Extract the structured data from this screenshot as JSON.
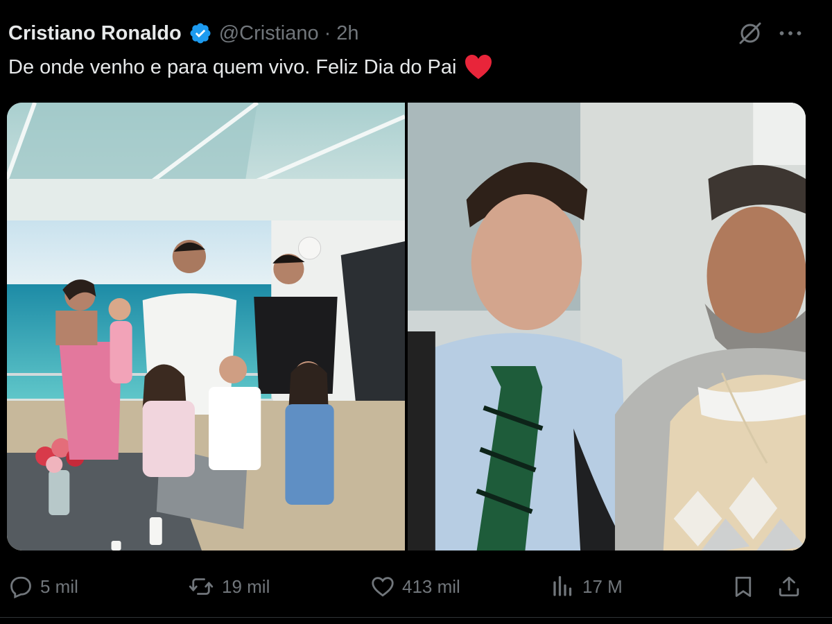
{
  "tweet": {
    "author_name": "Cristiano Ronaldo",
    "handle": "@Cristiano",
    "separator": "·",
    "time": "2h",
    "text": "De onde venho e para quem vivo. Feliz Dia do Pai",
    "emoji": "red-heart",
    "media": [
      {
        "name": "family-on-yacht-photo"
      },
      {
        "name": "young-ronaldo-with-father-photo"
      }
    ]
  },
  "actions": {
    "replies": "5 mil",
    "reposts": "19 mil",
    "likes": "413 mil",
    "views": "17 M"
  },
  "icons": [
    "verified-badge-icon",
    "grok-icon",
    "more-icon",
    "reply-icon",
    "repost-icon",
    "like-icon",
    "views-icon",
    "bookmark-icon",
    "share-icon"
  ],
  "colors": {
    "background": "#000000",
    "text": "#e7e9ea",
    "secondary": "#71767b",
    "verified": "#1d9bf0",
    "heart": "#f91880"
  }
}
